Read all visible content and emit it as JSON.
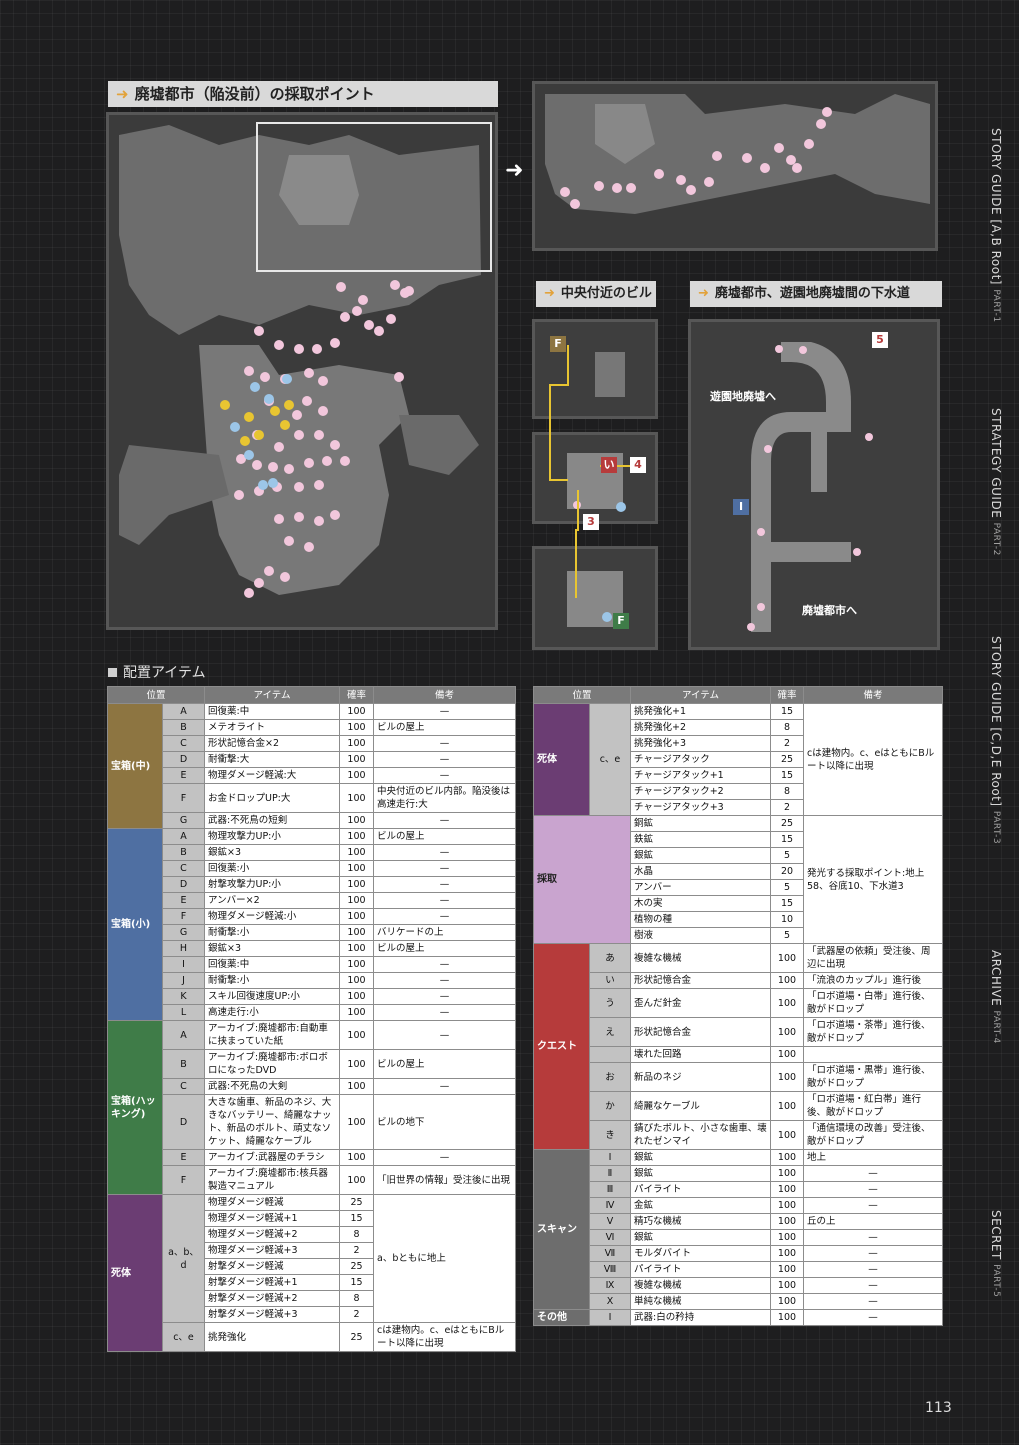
{
  "headers": {
    "main": "廃墟都市（陥没前）の採取ポイント",
    "center": "中央付近のビル",
    "sewer": "廃墟都市、遊園地廃墟間の下水道"
  },
  "labels": {
    "F": "F",
    "I": "I",
    "i_kana": "い",
    "n3": "3",
    "n4": "4",
    "n5": "5",
    "to_park": "遊園地廃墟へ",
    "to_city": "廃墟都市へ"
  },
  "sidebar": [
    {
      "title": "STORY GUIDE [A,B Root]",
      "sub": "PART-1"
    },
    {
      "title": "STRATEGY GUIDE",
      "sub": "PART-2"
    },
    {
      "title": "STORY GUIDE [C,D,E Root]",
      "sub": "PART-3"
    },
    {
      "title": "ARCHIVE",
      "sub": "PART-4"
    },
    {
      "title": "SECRET",
      "sub": "PART-5"
    }
  ],
  "section_title": "配置アイテム",
  "table_headers": {
    "pos": "位置",
    "item": "アイテム",
    "rate": "確率",
    "note": "備考"
  },
  "left": {
    "medium": {
      "label": "宝箱(中)",
      "rows": [
        [
          "A",
          "回復薬:中",
          "100",
          "—"
        ],
        [
          "B",
          "メテオライト",
          "100",
          "ビルの屋上"
        ],
        [
          "C",
          "形状記憶合金×2",
          "100",
          "—"
        ],
        [
          "D",
          "耐衝撃:大",
          "100",
          "—"
        ],
        [
          "E",
          "物理ダメージ軽減:大",
          "100",
          "—"
        ],
        [
          "F",
          "お金ドロップUP:大",
          "100",
          "中央付近のビル内部。陥没後は高速走行:大"
        ],
        [
          "G",
          "武器:不死鳥の短剣",
          "100",
          "—"
        ]
      ]
    },
    "small": {
      "label": "宝箱(小)",
      "rows": [
        [
          "A",
          "物理攻撃力UP:小",
          "100",
          "ビルの屋上"
        ],
        [
          "B",
          "銀鉱×3",
          "100",
          "—"
        ],
        [
          "C",
          "回復薬:小",
          "100",
          "—"
        ],
        [
          "D",
          "射撃攻撃力UP:小",
          "100",
          "—"
        ],
        [
          "E",
          "アンバー×2",
          "100",
          "—"
        ],
        [
          "F",
          "物理ダメージ軽減:小",
          "100",
          "—"
        ],
        [
          "G",
          "耐衝撃:小",
          "100",
          "バリケードの上"
        ],
        [
          "H",
          "銀鉱×3",
          "100",
          "ビルの屋上"
        ],
        [
          "I",
          "回復薬:中",
          "100",
          "—"
        ],
        [
          "J",
          "耐衝撃:小",
          "100",
          "—"
        ],
        [
          "K",
          "スキル回復速度UP:小",
          "100",
          "—"
        ],
        [
          "L",
          "高速走行:小",
          "100",
          "—"
        ]
      ]
    },
    "hack": {
      "label": "宝箱(ハッキング)",
      "rows": [
        [
          "A",
          "アーカイブ:廃墟都市:自動車に挟まっていた紙",
          "100",
          "—"
        ],
        [
          "B",
          "アーカイブ:廃墟都市:ボロボロになったDVD",
          "100",
          "ビルの屋上"
        ],
        [
          "C",
          "武器:不死鳥の大剣",
          "100",
          "—"
        ],
        [
          "D",
          "大きな歯車、新品のネジ、大きなバッテリー、綺麗なナット、新品のボルト、頑丈なソケット、綺麗なケーブル",
          "100",
          "ビルの地下"
        ],
        [
          "E",
          "アーカイブ:武器屋のチラシ",
          "100",
          "—"
        ],
        [
          "F",
          "アーカイブ:廃墟都市:核兵器製造マニュアル",
          "100",
          "「旧世界の情報」受注後に出現"
        ]
      ]
    },
    "body": {
      "label": "死体",
      "sub1": "a、b、d",
      "sub2": "c、e",
      "note1": "a、bともに地上",
      "note2": "cは建物内。c、eはともにBルート以降に出現",
      "rows": [
        [
          "物理ダメージ軽減",
          "25"
        ],
        [
          "物理ダメージ軽減+1",
          "15"
        ],
        [
          "物理ダメージ軽減+2",
          "8"
        ],
        [
          "物理ダメージ軽減+3",
          "2"
        ],
        [
          "射撃ダメージ軽減",
          "25"
        ],
        [
          "射撃ダメージ軽減+1",
          "15"
        ],
        [
          "射撃ダメージ軽減+2",
          "8"
        ],
        [
          "射撃ダメージ軽減+3",
          "2"
        ]
      ],
      "row2": [
        "挑発強化",
        "25"
      ]
    }
  },
  "right": {
    "body": {
      "label": "死体",
      "sub": "c、e",
      "note": "cは建物内。c、eはともにBルート以降に出現",
      "rows": [
        [
          "挑発強化+1",
          "15"
        ],
        [
          "挑発強化+2",
          "8"
        ],
        [
          "挑発強化+3",
          "2"
        ],
        [
          "チャージアタック",
          "25"
        ],
        [
          "チャージアタック+1",
          "15"
        ],
        [
          "チャージアタック+2",
          "8"
        ],
        [
          "チャージアタック+3",
          "2"
        ]
      ]
    },
    "gather": {
      "label": "採取",
      "note": "発光する採取ポイント:地上58、谷底10、下水道3",
      "rows": [
        [
          "銅鉱",
          "25"
        ],
        [
          "鉄鉱",
          "15"
        ],
        [
          "銀鉱",
          "5"
        ],
        [
          "水晶",
          "20"
        ],
        [
          "アンバー",
          "5"
        ],
        [
          "木の実",
          "15"
        ],
        [
          "植物の種",
          "10"
        ],
        [
          "樹液",
          "5"
        ]
      ]
    },
    "quest": {
      "label": "クエスト",
      "rows": [
        [
          "あ",
          "複雑な機械",
          "100",
          "「武器屋の依頼」受注後、周辺に出現"
        ],
        [
          "い",
          "形状記憶合金",
          "100",
          "「流浪のカップル」進行後"
        ],
        [
          "う",
          "歪んだ針金",
          "100",
          "「ロボ道場・白帯」進行後、敵がドロップ"
        ],
        [
          "え",
          "形状記憶合金",
          "100",
          "「ロボ道場・茶帯」進行後、敵がドロップ"
        ],
        [
          "",
          "壊れた回路",
          "100",
          ""
        ],
        [
          "お",
          "新品のネジ",
          "100",
          "「ロボ道場・黒帯」進行後、敵がドロップ"
        ],
        [
          "か",
          "綺麗なケーブル",
          "100",
          "「ロボ道場・紅白帯」進行後、敵がドロップ"
        ],
        [
          "き",
          "錆びたボルト、小さな歯車、壊れたゼンマイ",
          "100",
          "「通信環境の改善」受注後、敵がドロップ"
        ]
      ]
    },
    "scan": {
      "label": "スキャン",
      "rows": [
        [
          "Ⅰ",
          "銀鉱",
          "100",
          "地上"
        ],
        [
          "Ⅱ",
          "銀鉱",
          "100",
          "—"
        ],
        [
          "Ⅲ",
          "パイライト",
          "100",
          "—"
        ],
        [
          "Ⅳ",
          "金鉱",
          "100",
          "—"
        ],
        [
          "Ⅴ",
          "精巧な機械",
          "100",
          "丘の上"
        ],
        [
          "Ⅵ",
          "銀鉱",
          "100",
          "—"
        ],
        [
          "Ⅶ",
          "モルダバイト",
          "100",
          "—"
        ],
        [
          "Ⅷ",
          "パイライト",
          "100",
          "—"
        ],
        [
          "Ⅸ",
          "複雑な機械",
          "100",
          "—"
        ],
        [
          "Ⅹ",
          "単純な機械",
          "100",
          "—"
        ]
      ]
    },
    "other": {
      "label": "その他",
      "row": [
        "Ⅰ",
        "武器:白の矜持",
        "100",
        "—"
      ]
    }
  },
  "colors": {
    "medium": "#8d7541",
    "small": "#4f6fa2",
    "hack": "#3f7c48",
    "body": "#6b3d73",
    "gather": "#c9a4cf",
    "quest": "#b63b3b",
    "scan": "#6d6d6d",
    "pink": "#f2c7dc",
    "yellow": "#e8c531",
    "blue": "#9cc6e8"
  },
  "page_number": "113"
}
